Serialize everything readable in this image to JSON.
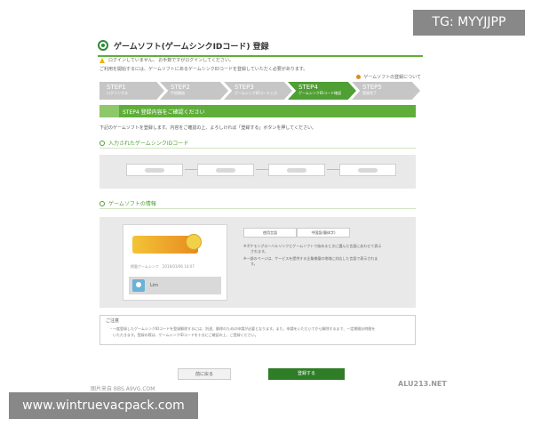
{
  "page": {
    "title": "ゲームソフト(ゲームシンクIDコード) 登録",
    "warning": "ログインしていません。 お手数ですがログインしてください。",
    "intro": "ご利用を開始するには、ゲームソフトにあるゲームシンクIDコードを登録していただく必要があります。",
    "help_link": "ゲームソフトの登録について"
  },
  "steps": [
    {
      "num": "STEP1",
      "sub": "ログインする"
    },
    {
      "num": "STEP2",
      "sub": "手続開始"
    },
    {
      "num": "STEP3",
      "sub": "ゲームシンクIDコード入力"
    },
    {
      "num": "STEP4",
      "sub": "ゲームシンクIDコード確認"
    },
    {
      "num": "STEP5",
      "sub": "登録完了"
    }
  ],
  "banner": "STEP4 登録内容をご確認ください",
  "description": "下記のゲームソフトを登録します。内容をご確認の上、よろしければ「登録する」ボタンを押してください。",
  "code_section": {
    "heading": "入力されたゲームシンクIDコード"
  },
  "game_section": {
    "heading": "ゲームソフトの情報",
    "meta": "掲載ゲームシンク　2016/03/06 14:07",
    "user_name": "Lim",
    "lang_btn_1": "使用言語",
    "lang_btn_2": "中国語(簡体字)",
    "note_1": "※ポケモングローバルリンクとゲームソフトで始めるときに選んだ言語にあわせて表示",
    "note_1b": "されます。",
    "note_2": "※一部のページは、サービスを提供する企業様優の地域に対応した言語で表示されま",
    "note_2b": "す。"
  },
  "notice": {
    "title": "ご注意",
    "line_1": "・一度登録したゲームシンクIDコードを登録解除するには、別途、解除のための申請が必要となります。また、申請をいただいてから解除するまで、一定期間お時間を",
    "line_2": "　いただきます。登録の際は、ゲームシンクIDコードを十分にご確認の上、ご登録ください。"
  },
  "buttons": {
    "back": "前に戻る",
    "register": "登録する"
  },
  "watermarks": {
    "tg": "TG: MYYJJPP",
    "site": "www.wintruevacpack.com",
    "small": "图片来自 BBS.A9VG.COM",
    "alu": "ALU213.NET"
  },
  "colors": {
    "accent": "#5fae3a",
    "register_button": "#2f7d27"
  }
}
